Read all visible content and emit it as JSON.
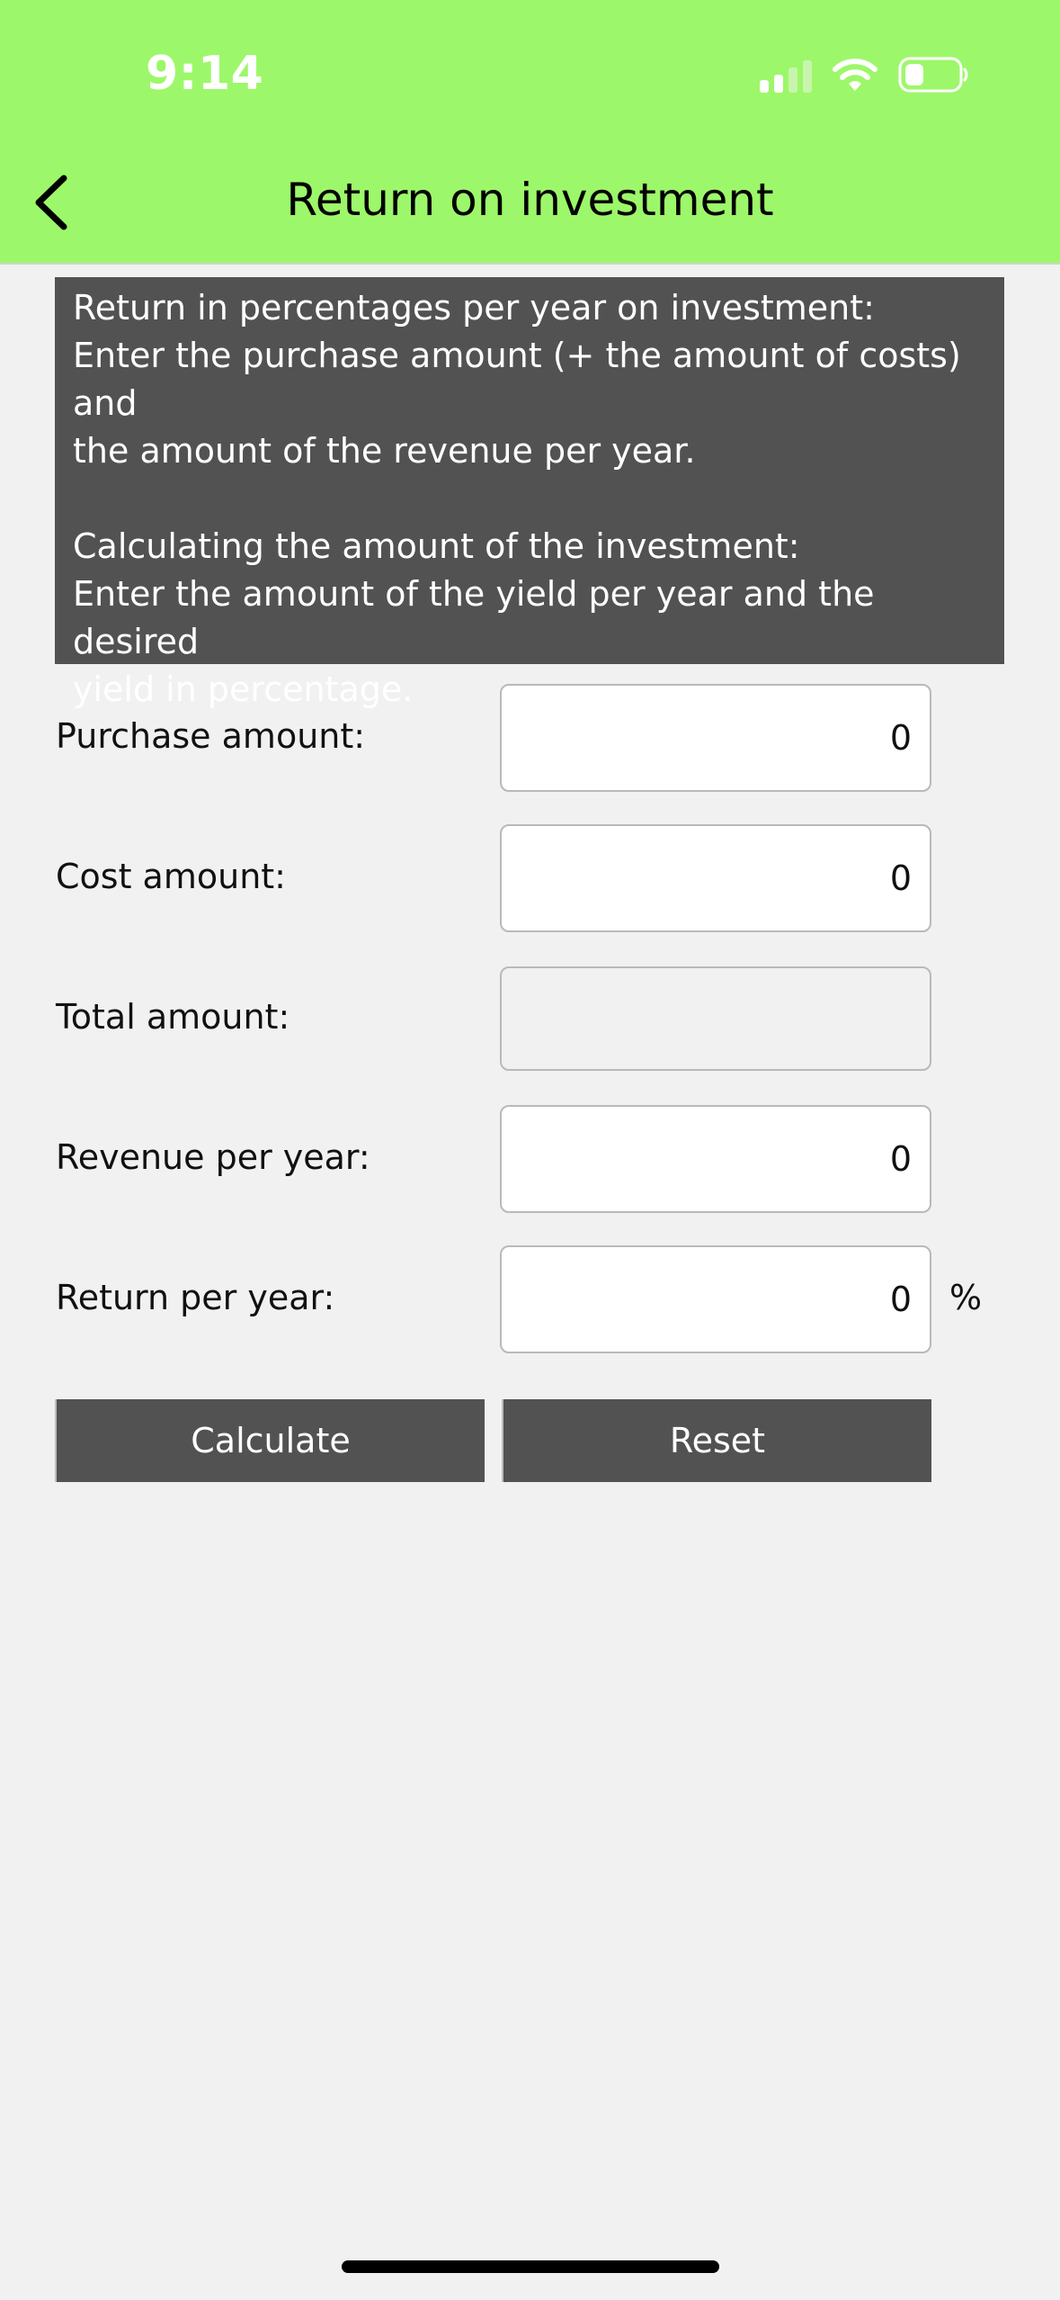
{
  "status_bar": {
    "time": "9:14"
  },
  "nav": {
    "title": "Return on investment",
    "back_icon": "chevron-left-icon"
  },
  "info": {
    "lines_1": [
      "Return in percentages per year on investment:",
      "Enter the purchase amount (+ the amount of costs) and",
      "the amount of the revenue per year."
    ],
    "lines_2": [
      "Calculating the amount of the investment:",
      "Enter the amount of the yield per year and the desired",
      "yield in percentage."
    ]
  },
  "form": {
    "purchase": {
      "label": "Purchase amount:",
      "value": "0"
    },
    "cost": {
      "label": "Cost amount:",
      "value": "0"
    },
    "total": {
      "label": "Total amount:",
      "value": ""
    },
    "revenue": {
      "label": "Revenue per year:",
      "value": "0"
    },
    "return": {
      "label": "Return per year:",
      "value": "0",
      "unit": "%"
    }
  },
  "buttons": {
    "calculate": "Calculate",
    "reset": "Reset"
  },
  "colors": {
    "header_bg": "#9df76a",
    "panel_bg": "#525252",
    "page_bg": "#f1f1f1"
  }
}
